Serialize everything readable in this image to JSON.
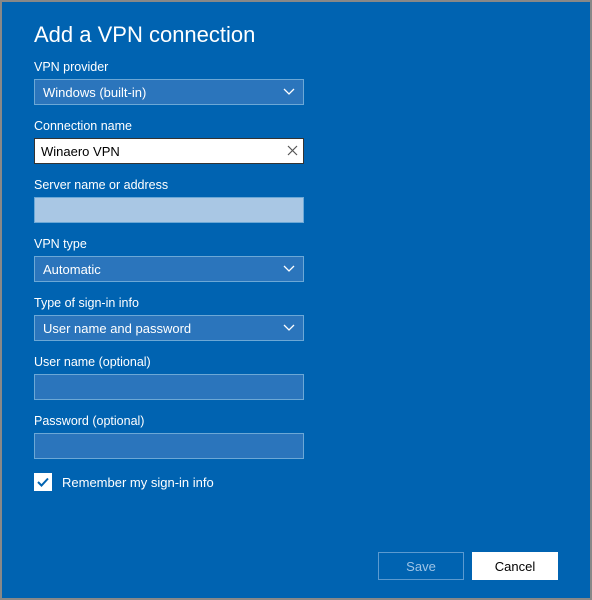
{
  "title": "Add a VPN connection",
  "fields": {
    "provider": {
      "label": "VPN provider",
      "value": "Windows (built-in)"
    },
    "connection": {
      "label": "Connection name",
      "value": "Winaero VPN"
    },
    "server": {
      "label": "Server name or address",
      "value": ""
    },
    "vpntype": {
      "label": "VPN type",
      "value": "Automatic"
    },
    "signintype": {
      "label": "Type of sign-in info",
      "value": "User name and password"
    },
    "username": {
      "label": "User name (optional)",
      "value": ""
    },
    "password": {
      "label": "Password (optional)",
      "value": ""
    }
  },
  "remember": {
    "label": "Remember my sign-in info",
    "checked": true
  },
  "buttons": {
    "save": "Save",
    "cancel": "Cancel"
  }
}
